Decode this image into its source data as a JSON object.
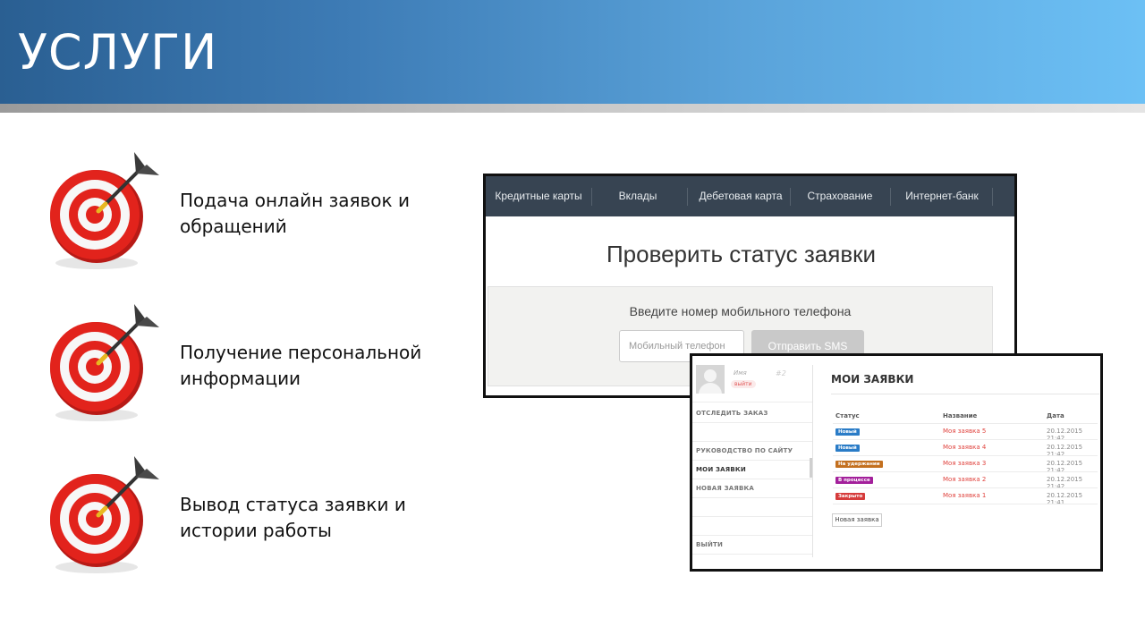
{
  "slide": {
    "title": "УСЛУГИ"
  },
  "features": [
    {
      "icon": "dartboard-target-icon",
      "line1": "Подача онлайн заявок и",
      "line2": "обращений"
    },
    {
      "icon": "dartboard-target-icon",
      "line1": "Получение персональной",
      "line2": "информации"
    },
    {
      "icon": "dartboard-target-icon",
      "line1": "Вывод статуса заявки и",
      "line2": "истории работы"
    }
  ],
  "status_check": {
    "nav": [
      "Кредитные карты",
      "Вклады",
      "Дебетовая карта",
      "Страхование",
      "Интернет-банк"
    ],
    "title": "Проверить статус заявки",
    "prompt": "Введите номер мобильного телефона",
    "phone_placeholder": "Мобильный телефон",
    "submit_label": "Отправить SMS"
  },
  "requests": {
    "user": {
      "name": "Имя",
      "id": "#2",
      "logout": "выйти"
    },
    "sidebar": {
      "track": "ОТСЛЕДИТЬ ЗАКАЗ",
      "guide": "РУКОВОДСТВО ПО САЙТУ",
      "my_requests": "МОИ ЗАЯВКИ",
      "new_request": "НОВАЯ ЗАЯВКА",
      "exit": "ВЫЙТИ"
    },
    "title": "МОИ ЗАЯВКИ",
    "columns": {
      "status": "Статус",
      "name": "Название",
      "date": "Дата"
    },
    "rows": [
      {
        "status": "Новый",
        "status_color": "#2a7cc7",
        "name": "Моя заявка 5",
        "date": "20.12.2015 21:42"
      },
      {
        "status": "Новый",
        "status_color": "#2a7cc7",
        "name": "Моя заявка 4",
        "date": "20.12.2015 21:42"
      },
      {
        "status": "На удержании",
        "status_color": "#c3701f",
        "name": "Моя заявка 3",
        "date": "20.12.2015 21:42"
      },
      {
        "status": "В процессе",
        "status_color": "#a3209b",
        "name": "Моя заявка 2",
        "date": "20.12.2015 21:42"
      },
      {
        "status": "Закрыто",
        "status_color": "#d63b3b",
        "name": "Моя заявка 1",
        "date": "20.12.2015 21:41"
      }
    ],
    "new_button": "Новая заявка"
  },
  "colors": {
    "nav_background": "#374452",
    "link_red": "#e0443f"
  }
}
